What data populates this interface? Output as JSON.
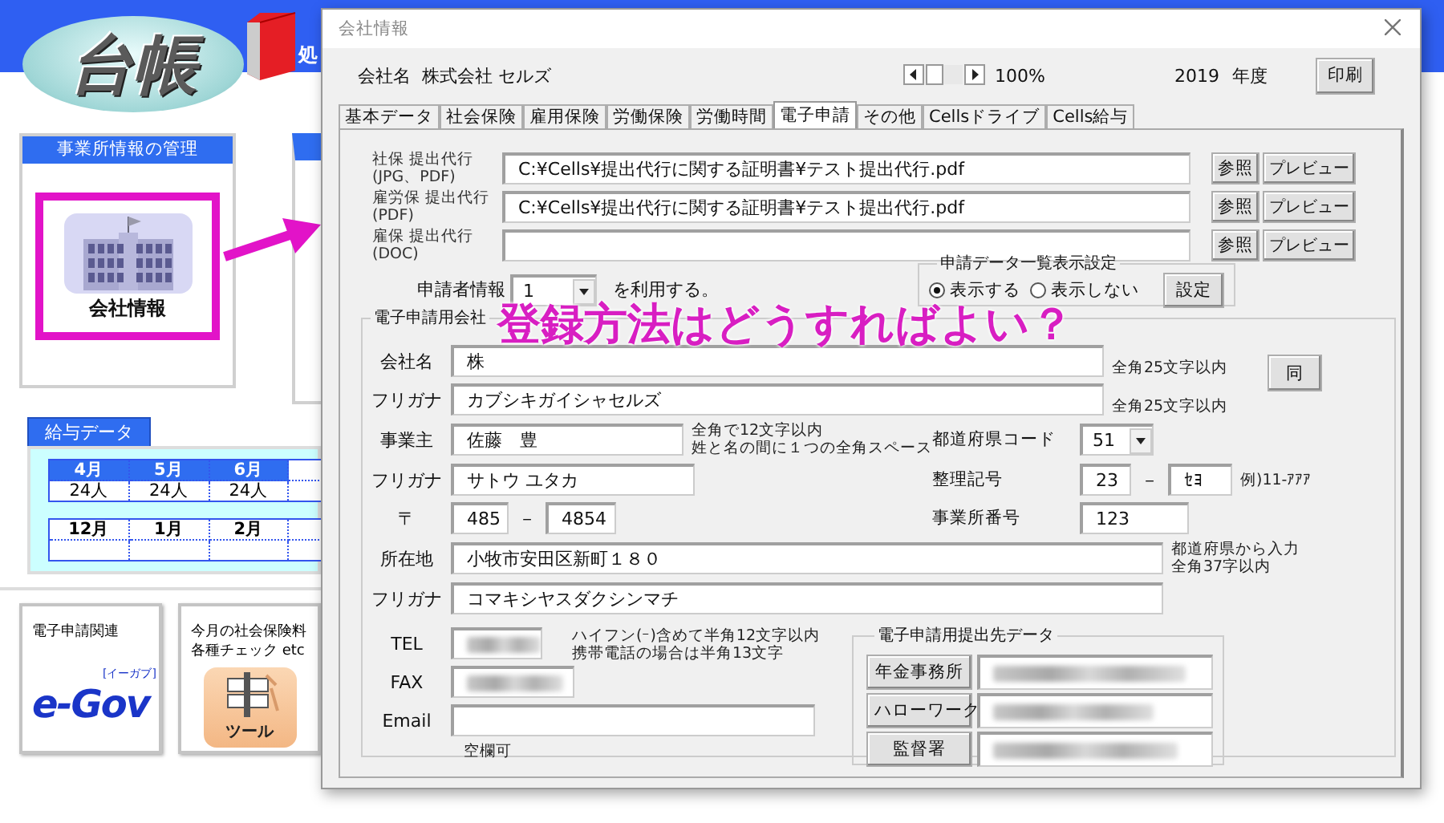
{
  "app": {
    "logo": "台帳",
    "header_text": "処",
    "office_panel": {
      "title": "事業所情報の管理",
      "button": "会社情報"
    },
    "salary_panel": {
      "title": "給与データ",
      "tables": [
        {
          "months": [
            "4月",
            "5月",
            "6月"
          ],
          "counts": [
            "24人",
            "24人",
            "24人"
          ]
        },
        {
          "months": [
            "12月",
            "1月",
            "2月"
          ]
        }
      ]
    },
    "tiles": [
      {
        "kind": "egov",
        "lines": [
          "電子申請関連"
        ],
        "logo": "e-Gov",
        "logo_reading": "[イーガブ]"
      },
      {
        "kind": "tool",
        "lines": [
          "今月の社会保険料",
          "各種チェック etc"
        ],
        "button": "ツール"
      }
    ]
  },
  "dialog": {
    "title": "会社情報",
    "company_label": "会社名",
    "company_name": "株式会社 セルズ",
    "zoom": "100%",
    "year": "2019",
    "year_unit": "年度",
    "print_button": "印刷",
    "tabs": [
      {
        "label": "基本データ",
        "selected": false
      },
      {
        "label": "社会保険",
        "selected": false
      },
      {
        "label": "雇用保険",
        "selected": false
      },
      {
        "label": "労働保険",
        "selected": false
      },
      {
        "label": "労働時間",
        "selected": false
      },
      {
        "label": "電子申請",
        "selected": true
      },
      {
        "label": "その他",
        "selected": false
      },
      {
        "label": "Cellsドライブ",
        "selected": false
      },
      {
        "label": "Cells給与",
        "selected": false
      }
    ],
    "files": [
      {
        "label_lines": [
          "社保 提出代行",
          "(JPG、PDF)"
        ],
        "value": "C:¥Cells¥提出代行に関する証明書¥テスト提出代行.pdf",
        "buttons": [
          "参照",
          "プレビュー"
        ]
      },
      {
        "label_lines": [
          "雇労保 提出代行",
          "(PDF)"
        ],
        "value": "C:¥Cells¥提出代行に関する証明書¥テスト提出代行.pdf",
        "buttons": [
          "参照",
          "プレビュー"
        ]
      },
      {
        "label_lines": [
          "雇保 提出代行",
          "(DOC)"
        ],
        "buttons": [
          "参照",
          "プレビュー"
        ]
      }
    ],
    "applicant": {
      "label": "申請者情報",
      "value": "1",
      "suffix": "を利用する。"
    },
    "list_display": {
      "title": "申請データ一覧表示設定",
      "options": [
        {
          "label": "表示する",
          "selected": true
        },
        {
          "label": "表示しない",
          "selected": false
        }
      ],
      "button": "設定"
    },
    "company_group": {
      "title": "電子申請用会社",
      "name": {
        "label": "会社名",
        "value": "株",
        "note": "全角25文字以内"
      },
      "name_kana": {
        "label": "フリガナ",
        "value": "カブシキガイシャセルズ",
        "note": "全角25文字以内"
      },
      "same_button": "同",
      "owner": {
        "label": "事業主",
        "value": "佐藤　豊",
        "notes": [
          "全角で12文字以内",
          "姓と名の間に１つの全角スペース"
        ]
      },
      "owner_kana": {
        "label": "フリガナ",
        "value": "サトウ ユタカ"
      },
      "postal": {
        "label": "〒",
        "first": "485",
        "separator": "－",
        "second": "4854"
      },
      "prefecture": {
        "label": "都道府県コード",
        "value": "51"
      },
      "reference": {
        "label": "整理記号",
        "first": "23",
        "separator": "－",
        "second": "ｾﾖ",
        "example": "例)11-ｱｱｱ"
      },
      "office_number": {
        "label": "事業所番号",
        "value": "123"
      },
      "address": {
        "label": "所在地",
        "value": "小牧市安田区新町１８０",
        "notes": [
          "都道府県から入力",
          "全角37字以内"
        ]
      },
      "address_kana": {
        "label": "フリガナ",
        "value": "コマキシヤスダクシンマチ"
      },
      "tel": {
        "label": "TEL",
        "blurred": true,
        "notes": [
          "ハイフン(ｰ)含めて半角12文字以内",
          "携帯電話の場合は半角13文字"
        ]
      },
      "fax": {
        "label": "FAX",
        "blurred": true
      },
      "email": {
        "label": "Email",
        "note": "空欄可"
      },
      "submission": {
        "title": "電子申請用提出先データ",
        "rows": [
          {
            "button": "年金事務所",
            "blurred": true
          },
          {
            "button": "ハローワーク",
            "blurred": true
          },
          {
            "button": "監督署",
            "blurred": true
          }
        ]
      }
    }
  },
  "caption": "登録方法はどうすればよい？"
}
